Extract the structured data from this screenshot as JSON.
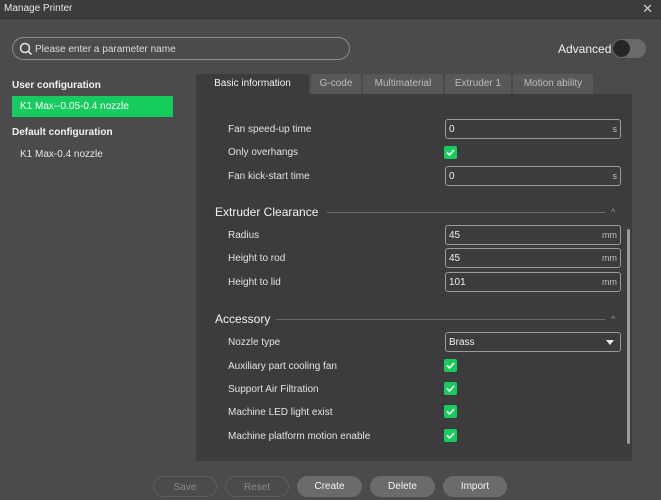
{
  "window": {
    "title": "Manage Printer",
    "close_glyph": "✕"
  },
  "search": {
    "placeholder": "Please enter a parameter name",
    "icon": "search-icon"
  },
  "advanced": {
    "label": "Advanced",
    "enabled": false
  },
  "sidebar": {
    "user_heading": "User configuration",
    "user_items": [
      "K1 Max--0.05-0.4 nozzle"
    ],
    "default_heading": "Default configuration",
    "default_items": [
      "K1 Max-0.4 nozzle"
    ]
  },
  "tabs": [
    "Basic information",
    "G-code",
    "Multimaterial",
    "Extruder 1",
    "Motion ability"
  ],
  "active_tab": "Basic information",
  "params": {
    "fan_speedup": {
      "label": "Fan speed-up time",
      "value": "0",
      "unit": "s"
    },
    "only_overhangs": {
      "label": "Only overhangs",
      "checked": true
    },
    "fan_kickstart": {
      "label": "Fan kick-start time",
      "value": "0",
      "unit": "s"
    }
  },
  "extruder_clearance": {
    "title": "Extruder Clearance",
    "radius": {
      "label": "Radius",
      "value": "45",
      "unit": "mm"
    },
    "height_rod": {
      "label": "Height to rod",
      "value": "45",
      "unit": "mm"
    },
    "height_lid": {
      "label": "Height to lid",
      "value": "101",
      "unit": "mm"
    }
  },
  "accessory": {
    "title": "Accessory",
    "nozzle_type": {
      "label": "Nozzle type",
      "value": "Brass"
    },
    "aux_fan": {
      "label": "Auxiliary part cooling fan",
      "checked": true
    },
    "air_filtration": {
      "label": "Support Air Filtration",
      "checked": true
    },
    "led_light": {
      "label": "Machine LED light exist",
      "checked": true
    },
    "platform_motion": {
      "label": "Machine platform motion enable",
      "checked": true
    }
  },
  "buttons": {
    "save": "Save",
    "reset": "Reset",
    "create": "Create",
    "delete": "Delete",
    "import": "Import"
  },
  "colors": {
    "accent": "#17cc5f",
    "background": "#4b4b4d",
    "panel": "#3c3c3e"
  }
}
